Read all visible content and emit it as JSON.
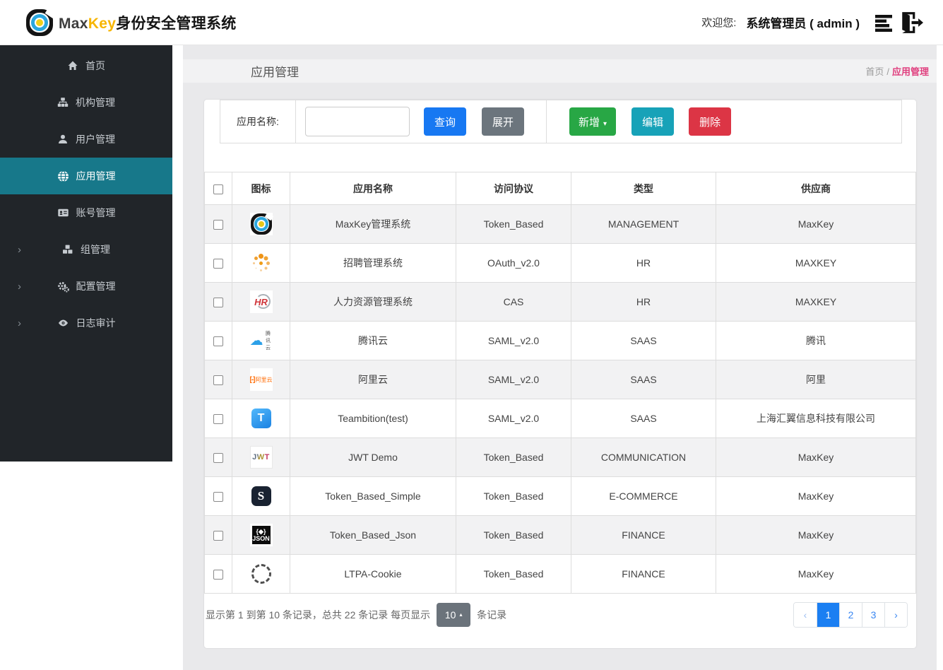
{
  "header": {
    "brand": {
      "word1": "Max",
      "word2": "Key",
      "word3": "身份安全管理系统"
    },
    "welcome_label": "欢迎您:",
    "user_display": "系统管理员 ( admin )",
    "icons": {
      "session_list": "list-icon",
      "logout": "logout-icon"
    }
  },
  "sidebar": {
    "items": [
      {
        "label": "首页",
        "icon": "home-icon",
        "chevron": "",
        "cls": ""
      },
      {
        "label": "机构管理",
        "icon": "sitemap-icon",
        "chevron": "",
        "cls": ""
      },
      {
        "label": "用户管理",
        "icon": "user-icon",
        "chevron": "",
        "cls": ""
      },
      {
        "label": "应用管理",
        "icon": "globe-icon",
        "chevron": "",
        "cls": "active"
      },
      {
        "label": "账号管理",
        "icon": "id-card-icon",
        "chevron": "",
        "cls": ""
      },
      {
        "label": "组管理",
        "icon": "cubes-icon",
        "chevron": "›",
        "cls": ""
      },
      {
        "label": "配置管理",
        "icon": "gears-icon",
        "chevron": "›",
        "cls": ""
      },
      {
        "label": "日志审计",
        "icon": "eye-icon",
        "chevron": "›",
        "cls": ""
      }
    ]
  },
  "page": {
    "title": "应用管理",
    "breadcrumb_root": "首页",
    "breadcrumb_sep": "/",
    "breadcrumb_current": "应用管理"
  },
  "toolbar": {
    "search_label": "应用名称:",
    "search_value": "",
    "query_label": "查询",
    "expand_label": "展开",
    "add_label": "新增",
    "add_caret": "▾",
    "edit_label": "编辑",
    "delete_label": "删除"
  },
  "table": {
    "headers": [
      "图标",
      "应用名称",
      "访问协议",
      "类型",
      "供应商"
    ],
    "rows": [
      {
        "icon": "ic-maxkey",
        "icon_name": "maxkey-app-icon",
        "name": "MaxKey管理系统",
        "protocol": "Token_Based",
        "type": "MANAGEMENT",
        "vendor": "MaxKey"
      },
      {
        "icon": "ic-spinner",
        "icon_name": "recruit-app-icon",
        "name": "招聘管理系统",
        "protocol": "OAuth_v2.0",
        "type": "HR",
        "vendor": "MAXKEY"
      },
      {
        "icon": "ic-hr",
        "icon_name": "hr-app-icon",
        "name": "人力资源管理系统",
        "protocol": "CAS",
        "type": "HR",
        "vendor": "MAXKEY"
      },
      {
        "icon": "ic-tencent",
        "icon_name": "tencent-cloud-icon",
        "name": "腾讯云",
        "protocol": "SAML_v2.0",
        "type": "SAAS",
        "vendor": "腾讯"
      },
      {
        "icon": "ic-aliyun",
        "icon_name": "aliyun-icon",
        "name": "阿里云",
        "protocol": "SAML_v2.0",
        "type": "SAAS",
        "vendor": "阿里"
      },
      {
        "icon": "ic-teambition",
        "icon_name": "teambition-icon",
        "name": "Teambition(test)",
        "protocol": "SAML_v2.0",
        "type": "SAAS",
        "vendor": "上海汇翼信息科技有限公司"
      },
      {
        "icon": "ic-jwt",
        "icon_name": "jwt-icon",
        "name": "JWT Demo",
        "protocol": "Token_Based",
        "type": "COMMUNICATION",
        "vendor": "MaxKey"
      },
      {
        "icon": "ic-s",
        "icon_name": "simple-app-icon",
        "name": "Token_Based_Simple",
        "protocol": "Token_Based",
        "type": "E-COMMERCE",
        "vendor": "MaxKey"
      },
      {
        "icon": "ic-json",
        "icon_name": "json-app-icon",
        "name": "Token_Based_Json",
        "protocol": "Token_Based",
        "type": "FINANCE",
        "vendor": "MaxKey"
      },
      {
        "icon": "ic-ltpa",
        "icon_name": "ltpa-cookie-icon",
        "name": "LTPA-Cookie",
        "protocol": "Token_Based",
        "type": "FINANCE",
        "vendor": "MaxKey"
      }
    ]
  },
  "pagination": {
    "summary_before": "显示第 1 到第 10 条记录，总共 22 条记录 每页显示",
    "page_size": "10",
    "page_size_caret": "▴",
    "summary_after": "条记录",
    "prev": "‹",
    "next": "›",
    "pages": [
      {
        "label": "1",
        "cls": "active"
      },
      {
        "label": "2",
        "cls": ""
      },
      {
        "label": "3",
        "cls": ""
      }
    ]
  },
  "colors": {
    "sidebar_bg": "#212529",
    "active_menu_teal": "#17788a",
    "primary_blue": "#1778f2",
    "add_green": "#28a745",
    "edit_teal": "#17a2b8",
    "delete_red": "#dc3545",
    "expand_gray": "#6c757d",
    "breadcrumb_pink": "#e0407f",
    "active_page_blue": "#1b7ff2",
    "brand_yellow": "#f7b500"
  }
}
